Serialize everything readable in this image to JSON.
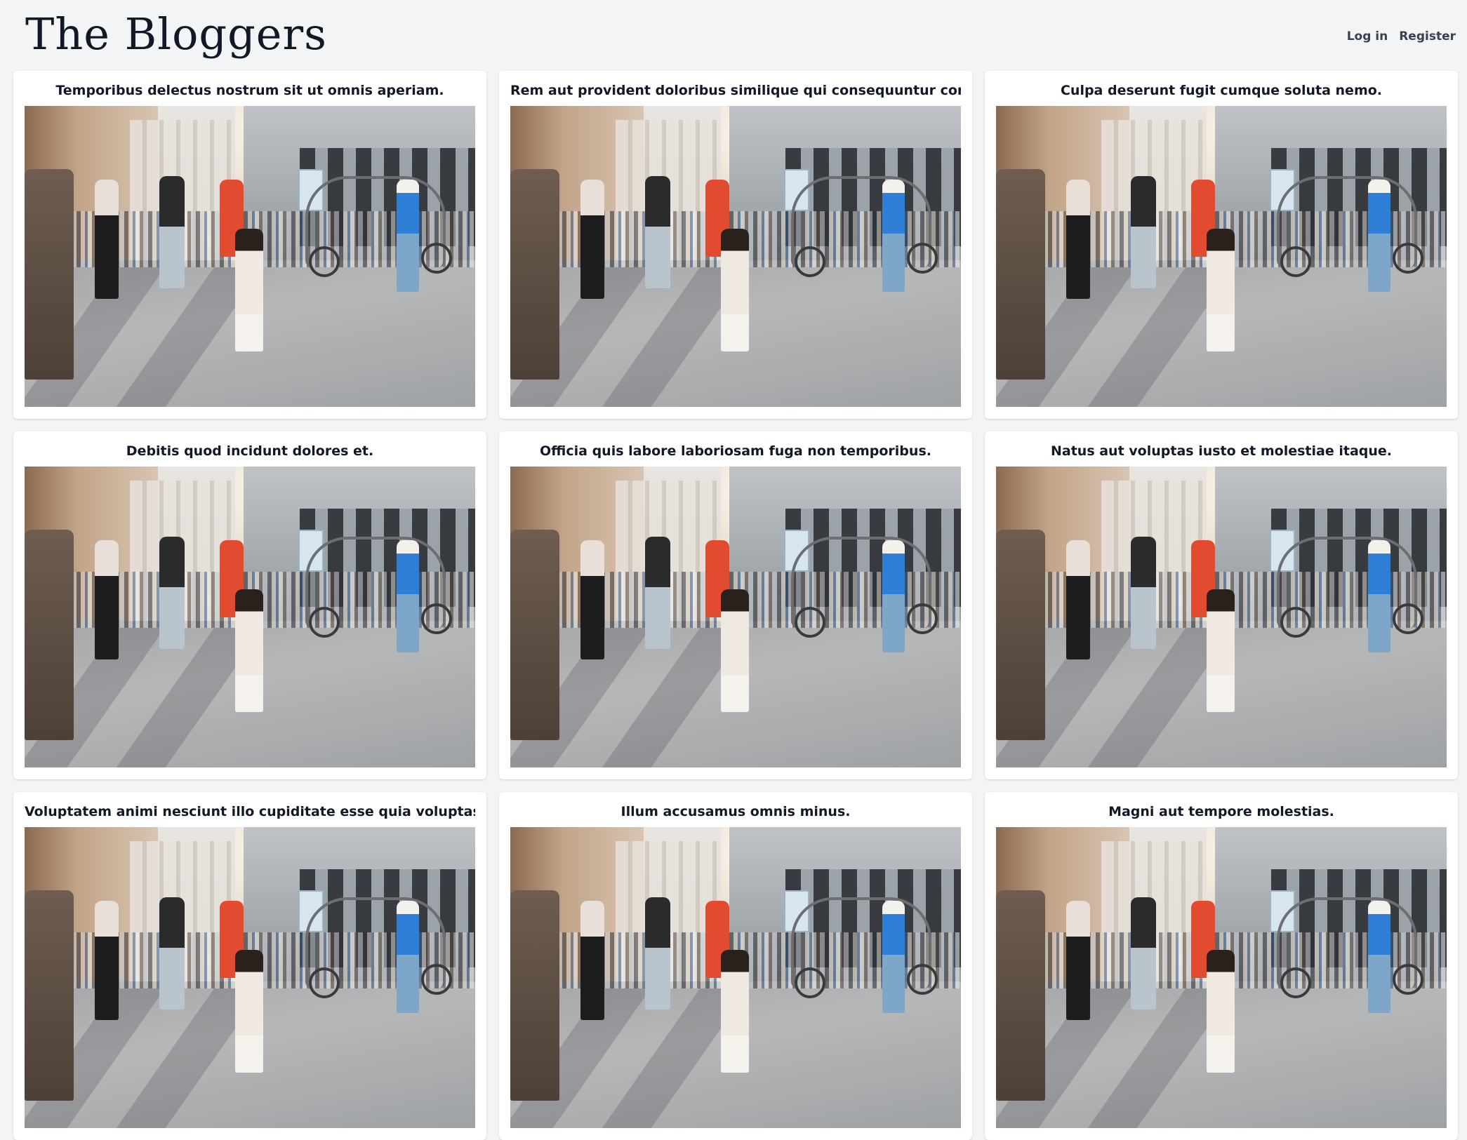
{
  "header": {
    "site_title": "The Bloggers",
    "nav": {
      "login_label": "Log in",
      "register_label": "Register"
    }
  },
  "posts": [
    {
      "title": "Temporibus delectus nostrum sit ut omnis aperiam."
    },
    {
      "title": "Rem aut provident doloribus similique qui consequuntur corrupti."
    },
    {
      "title": "Culpa deserunt fugit cumque soluta nemo."
    },
    {
      "title": "Debitis quod incidunt dolores et."
    },
    {
      "title": "Officia quis labore laboriosam fuga non temporibus."
    },
    {
      "title": "Natus aut voluptas iusto et molestiae itaque."
    },
    {
      "title": "Voluptatem animi nesciunt illo cupiditate esse quia voluptas est."
    },
    {
      "title": "Illum accusamus omnis minus."
    },
    {
      "title": "Magni aut tempore molestias."
    }
  ]
}
